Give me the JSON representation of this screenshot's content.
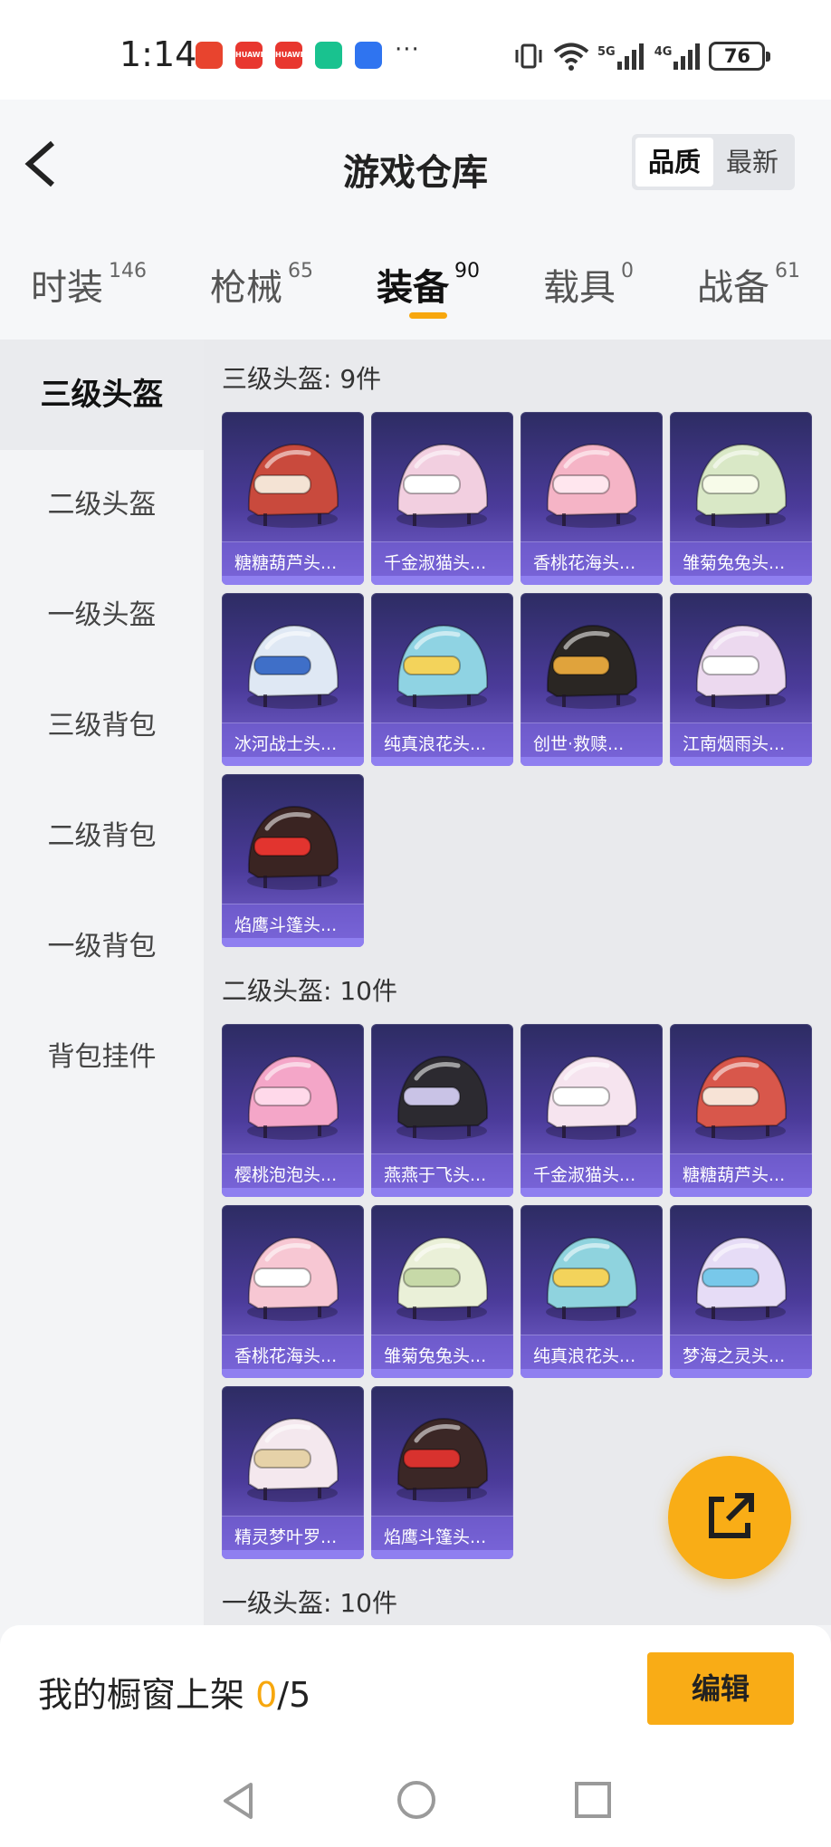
{
  "status_bar": {
    "time": "1:14",
    "notification_apps": [
      {
        "name": "phone-app",
        "color": "#e8442e",
        "text": ""
      },
      {
        "name": "huawei-app",
        "color": "#e8372f",
        "text": "HUAWEI"
      },
      {
        "name": "huawei-app-2",
        "color": "#e8372f",
        "text": "HUAWEI"
      },
      {
        "name": "security-app",
        "color": "#19c28f",
        "text": ""
      },
      {
        "name": "tips-app",
        "color": "#2f74f0",
        "text": ""
      }
    ],
    "more": "···",
    "signal_5g": "5G",
    "signal_4g": "4G",
    "battery": "76"
  },
  "header": {
    "title": "游戏仓库",
    "sort_options": [
      "品质",
      "最新"
    ],
    "active_sort": "品质"
  },
  "tabs": [
    {
      "label": "时装",
      "count": "146"
    },
    {
      "label": "枪械",
      "count": "65"
    },
    {
      "label": "装备",
      "count": "90",
      "active": true
    },
    {
      "label": "载具",
      "count": "0"
    },
    {
      "label": "战备",
      "count": "61"
    }
  ],
  "sidebar": {
    "items": [
      "三级头盔",
      "二级头盔",
      "一级头盔",
      "三级背包",
      "二级背包",
      "一级背包",
      "背包挂件"
    ],
    "active": "三级头盔"
  },
  "sections": [
    {
      "title": "三级头盔: 9件",
      "items": [
        {
          "name": "糖糖葫芦头...",
          "color": "#c94a3d",
          "accent": "#f4e3d4"
        },
        {
          "name": "千金淑猫头...",
          "color": "#f2cfe0",
          "accent": "#ffffff"
        },
        {
          "name": "香桃花海头...",
          "color": "#f5b4c6",
          "accent": "#ffe6ee"
        },
        {
          "name": "雏菊兔兔头...",
          "color": "#d9e8c6",
          "accent": "#f7fbe9"
        },
        {
          "name": "冰河战士头...",
          "color": "#dfe8f4",
          "accent": "#3f6fc8"
        },
        {
          "name": "纯真浪花头...",
          "color": "#8fd3e3",
          "accent": "#f3d35b"
        },
        {
          "name": "创世·救赎...",
          "color": "#2a2623",
          "accent": "#e0a33c"
        },
        {
          "name": "江南烟雨头...",
          "color": "#ecd9ef",
          "accent": "#ffffff"
        },
        {
          "name": "焰鹰斗篷头...",
          "color": "#3a2422",
          "accent": "#e2342f"
        }
      ]
    },
    {
      "title": "二级头盔: 10件",
      "items": [
        {
          "name": "樱桃泡泡头...",
          "color": "#f4a6c8",
          "accent": "#ffd9ea"
        },
        {
          "name": "燕燕于飞头...",
          "color": "#2c2a30",
          "accent": "#c9c3e6"
        },
        {
          "name": "千金淑猫头...",
          "color": "#f6e4ef",
          "accent": "#ffffff"
        },
        {
          "name": "糖糖葫芦头...",
          "color": "#d8574b",
          "accent": "#f7e3d6"
        },
        {
          "name": "香桃花海头...",
          "color": "#f7c7d3",
          "accent": "#ffffff"
        },
        {
          "name": "雏菊兔兔头...",
          "color": "#eaf0d8",
          "accent": "#c7d9a8"
        },
        {
          "name": "纯真浪花头...",
          "color": "#8fd3de",
          "accent": "#f3d35b"
        },
        {
          "name": "梦海之灵头...",
          "color": "#e6dcf6",
          "accent": "#78c8ea"
        },
        {
          "name": "精灵梦叶罗...",
          "color": "#f4e8ee",
          "accent": "#e6d2a8"
        },
        {
          "name": "焰鹰斗篷头...",
          "color": "#3b2726",
          "accent": "#d8322e"
        }
      ]
    },
    {
      "title": "一级头盔: 10件",
      "items": []
    }
  ],
  "bottom": {
    "shelf_label": "我的橱窗上架",
    "shelf_current": "0",
    "shelf_total": "/5",
    "edit_label": "编辑"
  },
  "nav": {
    "back": "back-nav",
    "home": "home-nav",
    "recents": "recents-nav"
  }
}
